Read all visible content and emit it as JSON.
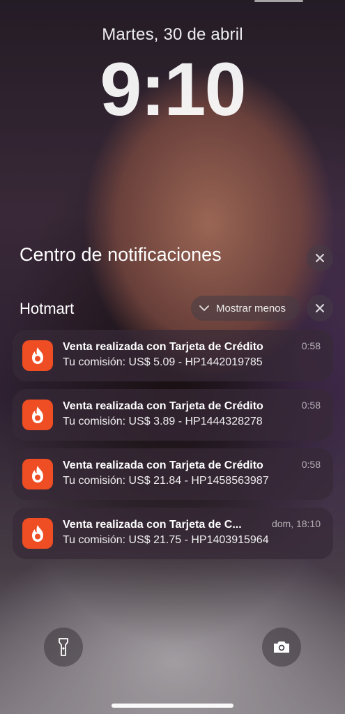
{
  "lockscreen": {
    "date": "Martes, 30 de abril",
    "time": "9:10"
  },
  "notification_center": {
    "title": "Centro de notificaciones"
  },
  "group": {
    "app_name": "Hotmart",
    "show_less_label": "Mostrar menos"
  },
  "notifications": [
    {
      "title": "Venta realizada con Tarjeta de Crédito",
      "body": "Tu comisión: US$ 5.09 - HP1442019785",
      "time": "0:58"
    },
    {
      "title": "Venta realizada con Tarjeta de Crédito",
      "body": "Tu comisión: US$ 3.89 - HP1444328278",
      "time": "0:58"
    },
    {
      "title": "Venta realizada con Tarjeta de Crédito",
      "body": "Tu comisión: US$ 21.84 - HP1458563987",
      "time": "0:58"
    },
    {
      "title": "Venta realizada con Tarjeta de C...",
      "body": "Tu comisión: US$ 21.75 - HP1403915964",
      "time": "dom, 18:10"
    }
  ],
  "icons": {
    "app": "hotmart-flame-icon",
    "flashlight": "flashlight-icon",
    "camera": "camera-icon",
    "close": "close-icon",
    "chevron": "chevron-down-icon"
  },
  "colors": {
    "hotmart_brand": "#ef4d23"
  }
}
